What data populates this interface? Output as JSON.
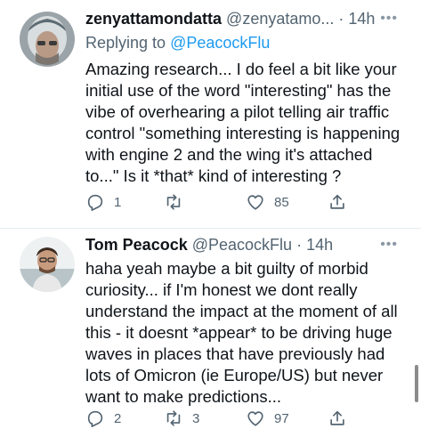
{
  "tweets": [
    {
      "name": "zenyattamondatta",
      "handle": "@zenyatamo...",
      "time": "14h",
      "reply_prefix": "Replying to ",
      "reply_handle": "@PeacockFlu",
      "text": "Amazing research... I do feel a bit like your\ninitial use of the word \"interesting\" has the\nvibe of overhearing a pilot telling air traffic\ncontrol \"something interesting is happening\nwith engine 2 and the wing it's attached\nto...\"  Is it *that* kind of interesting ?",
      "replies": "1",
      "retweets": "",
      "likes": "85"
    },
    {
      "name": "Tom Peacock",
      "handle": "@PeacockFlu",
      "time": "14h",
      "text": "haha yeah maybe a bit guilty of morbid\ncuriosity... if I'm honest we dont really\nunderstand the impact at the moment of all\nthis - it doesnt *appear* to be driving huge\nwaves in places that have previously had\nlots of Omicron (ie Europe/US) but never\nwant to make predictions...",
      "replies": "2",
      "retweets": "3",
      "likes": "97"
    }
  ],
  "separator": "·",
  "more_icon": "more-dots-icon",
  "icons": [
    "reply-icon",
    "retweet-icon",
    "like-icon",
    "share-icon"
  ],
  "colors": {
    "link": "#1d9bf0",
    "secondary": "#536471",
    "text": "#0f1419"
  }
}
